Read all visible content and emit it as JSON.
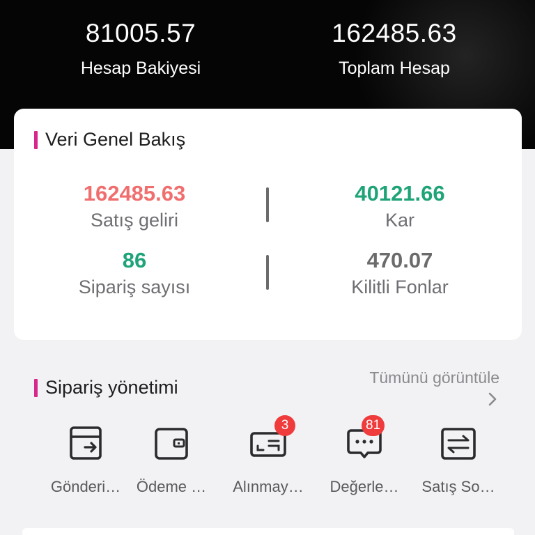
{
  "header": {
    "balance": {
      "value": "81005.57",
      "label": "Hesap Bakiyesi"
    },
    "total": {
      "value": "162485.63",
      "label": "Toplam Hesap"
    }
  },
  "overview": {
    "title": "Veri Genel Bakış",
    "metrics": [
      {
        "value": "162485.63",
        "label": "Satış geliri",
        "color": "#f06e6e"
      },
      {
        "value": "40121.66",
        "label": "Kar",
        "color": "#1fa378"
      },
      {
        "value": "86",
        "label": "Sipariş sayısı",
        "color": "#1fa378"
      },
      {
        "value": "470.07",
        "label": "Kilitli Fonlar",
        "color": "#6b6b6b"
      }
    ]
  },
  "orders": {
    "title": "Sipariş yönetimi",
    "view_all": "Tümünü görüntüle",
    "items": [
      {
        "label": "Gönderi…",
        "icon": "shipping-box-icon"
      },
      {
        "label": "Ödeme …",
        "icon": "wallet-icon"
      },
      {
        "label": "Alınmay…",
        "icon": "ticket-icon",
        "badge": "3"
      },
      {
        "label": "Değerle…",
        "icon": "chat-bubble-icon",
        "badge": "81"
      },
      {
        "label": "Satış So…",
        "icon": "transfer-icon"
      }
    ]
  },
  "colors": {
    "accent": "#d6288c",
    "badge": "#ef3b3b"
  }
}
